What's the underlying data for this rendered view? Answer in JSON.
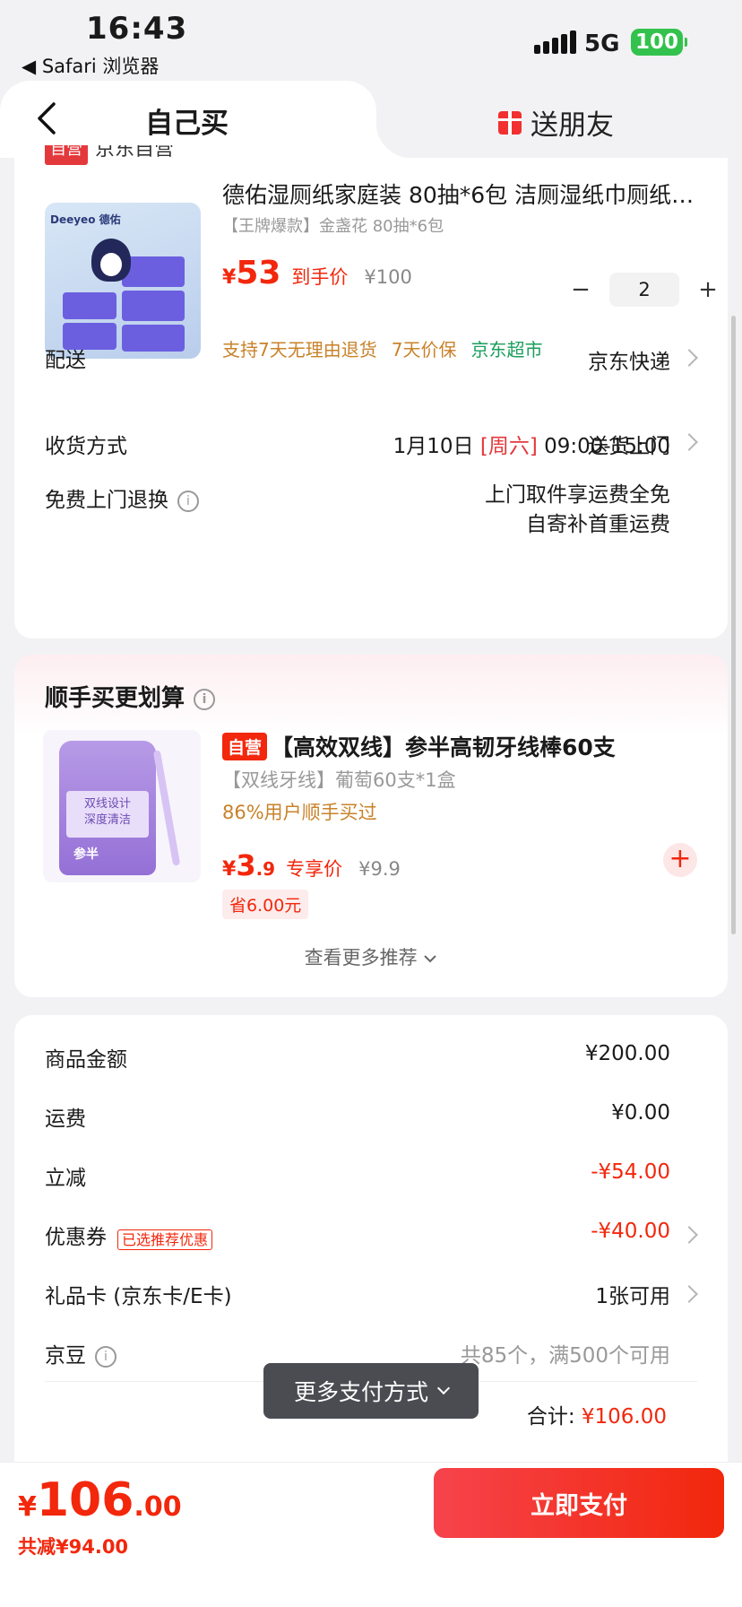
{
  "status_bar": {
    "time": "16:43",
    "back_app": "◀ Safari 浏览器",
    "network": "5G",
    "battery": "100"
  },
  "header": {
    "tab_self": "自己买",
    "tab_gift": "送朋友"
  },
  "store": {
    "badge": "自营",
    "name": "京东自营"
  },
  "product": {
    "brand": "Deeyeo 德佑",
    "title": "德佑湿厕纸家庭装 80抽*6包 洁厕湿纸巾厕纸…",
    "spec": "【王牌爆款】金盏花 80抽*6包",
    "yen": "¥",
    "price": "53",
    "price_tag": "到手价",
    "original_price": "¥100",
    "quantity": "2",
    "minus": "−",
    "plus": "+",
    "services": [
      "支持7天无理由退货",
      "7天价保",
      "京东超市"
    ]
  },
  "delivery": {
    "label": "配送",
    "carrier": "京东快递",
    "date": "1月10日",
    "weekday": "[周六]",
    "time_window": "09:00-15:00",
    "receive_label": "收货方式",
    "receive_value": "送货上门",
    "return_label": "免费上门退换",
    "return_line1": "上门取件享运费全免",
    "return_line2": "自寄补首重运费"
  },
  "recommend": {
    "title": "顺手买更划算",
    "badge": "自营",
    "name": "【高效双线】参半高韧牙线棒60支",
    "spec": "【双线牙线】葡萄60支*1盒",
    "bought": "86%用户顺手买过",
    "yen": "¥",
    "price_int": "3",
    "price_dec": ".9",
    "price_tag": "专享价",
    "original_price": "¥9.9",
    "save": "省6.00元",
    "image_text": "双线设计\n深度清洁",
    "image_brand": "参半",
    "more": "查看更多推荐"
  },
  "summary": {
    "goods_label": "商品金额",
    "goods_value": "¥200.00",
    "shipping_label": "运费",
    "shipping_value": "¥0.00",
    "discount_label": "立减",
    "discount_value": "-¥54.00",
    "coupon_label": "优惠券",
    "coupon_tag": "已选推荐优惠",
    "coupon_value": "-¥40.00",
    "giftcard_label": "礼品卡 (京东卡/E卡)",
    "giftcard_value": "1张可用",
    "beans_label": "京豆",
    "beans_value": "共85个，满500个可用",
    "total_label": "合计:",
    "total_value": "¥106.00"
  },
  "toast": {
    "label": "更多支付方式"
  },
  "bottom": {
    "yen": "¥",
    "int": "106",
    "dec": ".00",
    "saved": "共减¥94.00",
    "pay_button": "立即支付"
  },
  "colors": {
    "accent": "#f2270c",
    "service_orange": "#c9822a",
    "service_green": "#1a9e5c",
    "battery": "#33c24d"
  }
}
